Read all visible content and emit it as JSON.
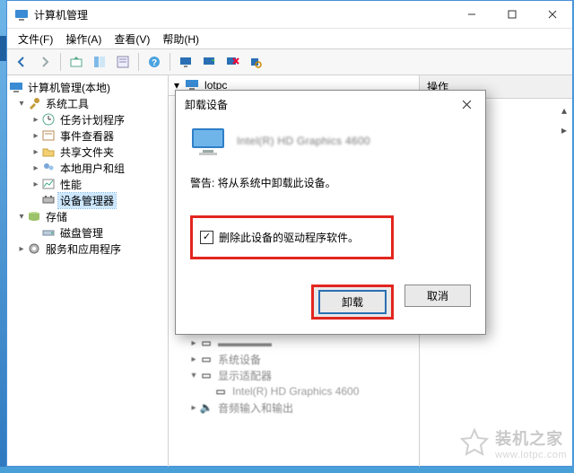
{
  "window": {
    "title": "计算机管理",
    "menus": {
      "file": "文件(F)",
      "action": "操作(A)",
      "view": "查看(V)",
      "help": "帮助(H)"
    }
  },
  "leftTree": {
    "root": "计算机管理(本地)",
    "group1": "系统工具",
    "items1": {
      "taskScheduler": "任务计划程序",
      "eventViewer": "事件查看器",
      "sharedFolders": "共享文件夹",
      "localUsers": "本地用户和组",
      "performance": "性能",
      "deviceManager": "设备管理器"
    },
    "group2": "存储",
    "items2": {
      "diskMgmt": "磁盘管理"
    },
    "group3": "服务和应用程序"
  },
  "mid": {
    "computer": "lotpc",
    "blur1": "系统设备",
    "blur2": "显示适配器",
    "blurDevice": "Intel(R) HD Graphics 4600",
    "blur3": "音频输入和输出"
  },
  "rightPane": {
    "header": "操作"
  },
  "dialog": {
    "title": "卸载设备",
    "device": "Intel(R) HD Graphics 4600",
    "warning": "警告: 将从系统中卸载此设备。",
    "checkbox": "删除此设备的驱动程序软件。",
    "uninstall": "卸载",
    "cancel": "取消"
  },
  "watermark": {
    "brand": "装机之家",
    "url": "www.lotpc.com"
  }
}
